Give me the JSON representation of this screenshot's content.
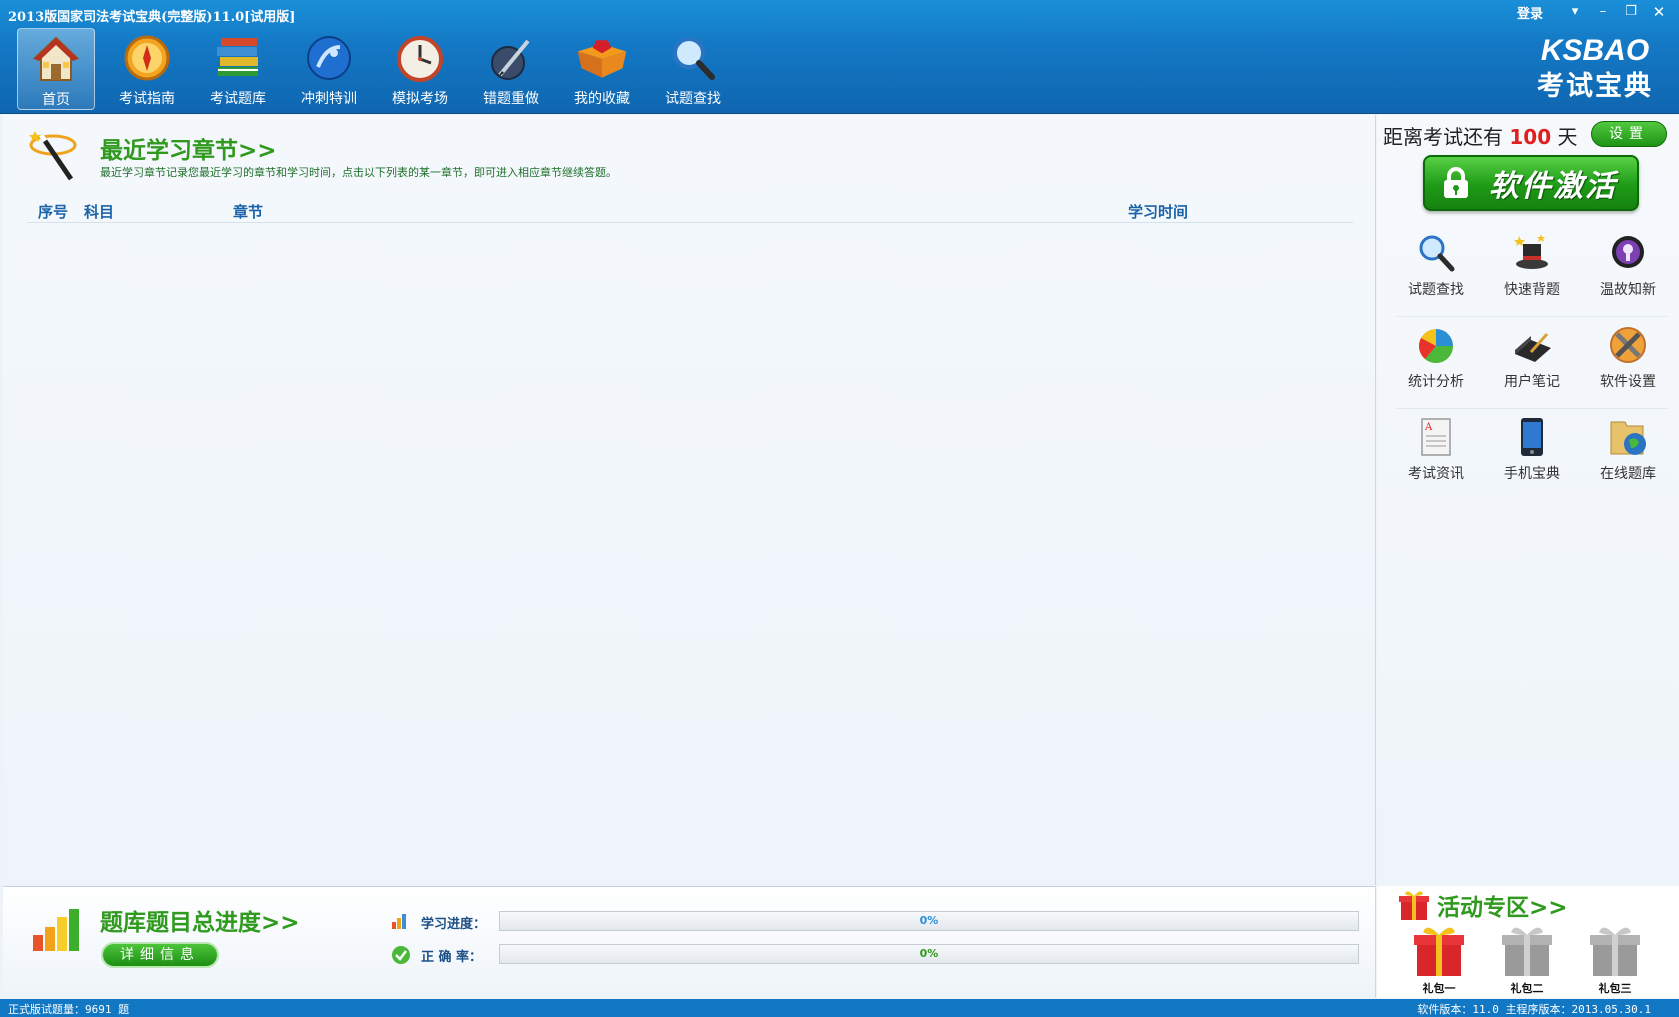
{
  "window": {
    "title": "2013版国家司法考试宝典(完整版)11.0[试用版]",
    "login_label": "登录",
    "controls": [
      "menu",
      "minimize",
      "restore",
      "close"
    ]
  },
  "toolbar": {
    "items": [
      {
        "label": "首页",
        "icon": "home-icon",
        "active": true
      },
      {
        "label": "考试指南",
        "icon": "compass-icon",
        "active": false
      },
      {
        "label": "考试题库",
        "icon": "books-icon",
        "active": false
      },
      {
        "label": "冲刺特训",
        "icon": "sprint-icon",
        "active": false
      },
      {
        "label": "模拟考场",
        "icon": "clock-icon",
        "active": false
      },
      {
        "label": "错题重做",
        "icon": "pen-icon",
        "active": false
      },
      {
        "label": "我的收藏",
        "icon": "treasure-box-icon",
        "active": false
      },
      {
        "label": "试题查找",
        "icon": "magnifier-icon",
        "active": false
      }
    ]
  },
  "brand": {
    "line1": "KSBAO",
    "line2": "考试宝典"
  },
  "recent": {
    "title": "最近学习章节>>",
    "description": "最近学习章节记录您最近学习的章节和学习时间，点击以下列表的某一章节，即可进入相应章节继续答题。",
    "columns": {
      "index": "序号",
      "subject": "科目",
      "chapter": "章节",
      "time": "学习时间"
    },
    "rows": []
  },
  "progress": {
    "title": "题库题目总进度>>",
    "detail_button": "详细信息",
    "study_label": "学习进度：",
    "study_value": 0,
    "study_text": "0%",
    "accuracy_label": "正 确 率：",
    "accuracy_value": 0,
    "accuracy_text": "0%"
  },
  "sidebar": {
    "countdown_prefix": "距离考试还有",
    "countdown_days": "100",
    "countdown_suffix": "天",
    "settings_button": "设置",
    "activate_button": "软件激活",
    "quick_items": [
      [
        {
          "label": "试题查找",
          "icon": "magnifier-icon"
        },
        {
          "label": "快速背题",
          "icon": "magic-hat-icon"
        },
        {
          "label": "温故知新",
          "icon": "lightbulb-icon"
        }
      ],
      [
        {
          "label": "统计分析",
          "icon": "pie-chart-icon"
        },
        {
          "label": "用户笔记",
          "icon": "notebook-icon"
        },
        {
          "label": "软件设置",
          "icon": "tools-icon"
        }
      ],
      [
        {
          "label": "考试资讯",
          "icon": "document-icon"
        },
        {
          "label": "手机宝典",
          "icon": "phone-icon"
        },
        {
          "label": "在线题库",
          "icon": "globe-folder-icon"
        }
      ]
    ]
  },
  "activity": {
    "title": "活动专区>>",
    "gifts": [
      {
        "label": "礼包一",
        "color": "#d8262a"
      },
      {
        "label": "礼包二",
        "color": "#9a9a9a"
      },
      {
        "label": "礼包三",
        "color": "#9a9a9a"
      }
    ]
  },
  "status": {
    "left": "正式版试题量：9691 题",
    "right": "软件版本：11.0 主程序版本：2013.05.30.1"
  },
  "colors": {
    "title_bar": "#1478c4",
    "heading_green": "#2f9a1e",
    "column_blue": "#1b63a8",
    "countdown_red": "#e02020",
    "button_green": "#1f9417"
  }
}
